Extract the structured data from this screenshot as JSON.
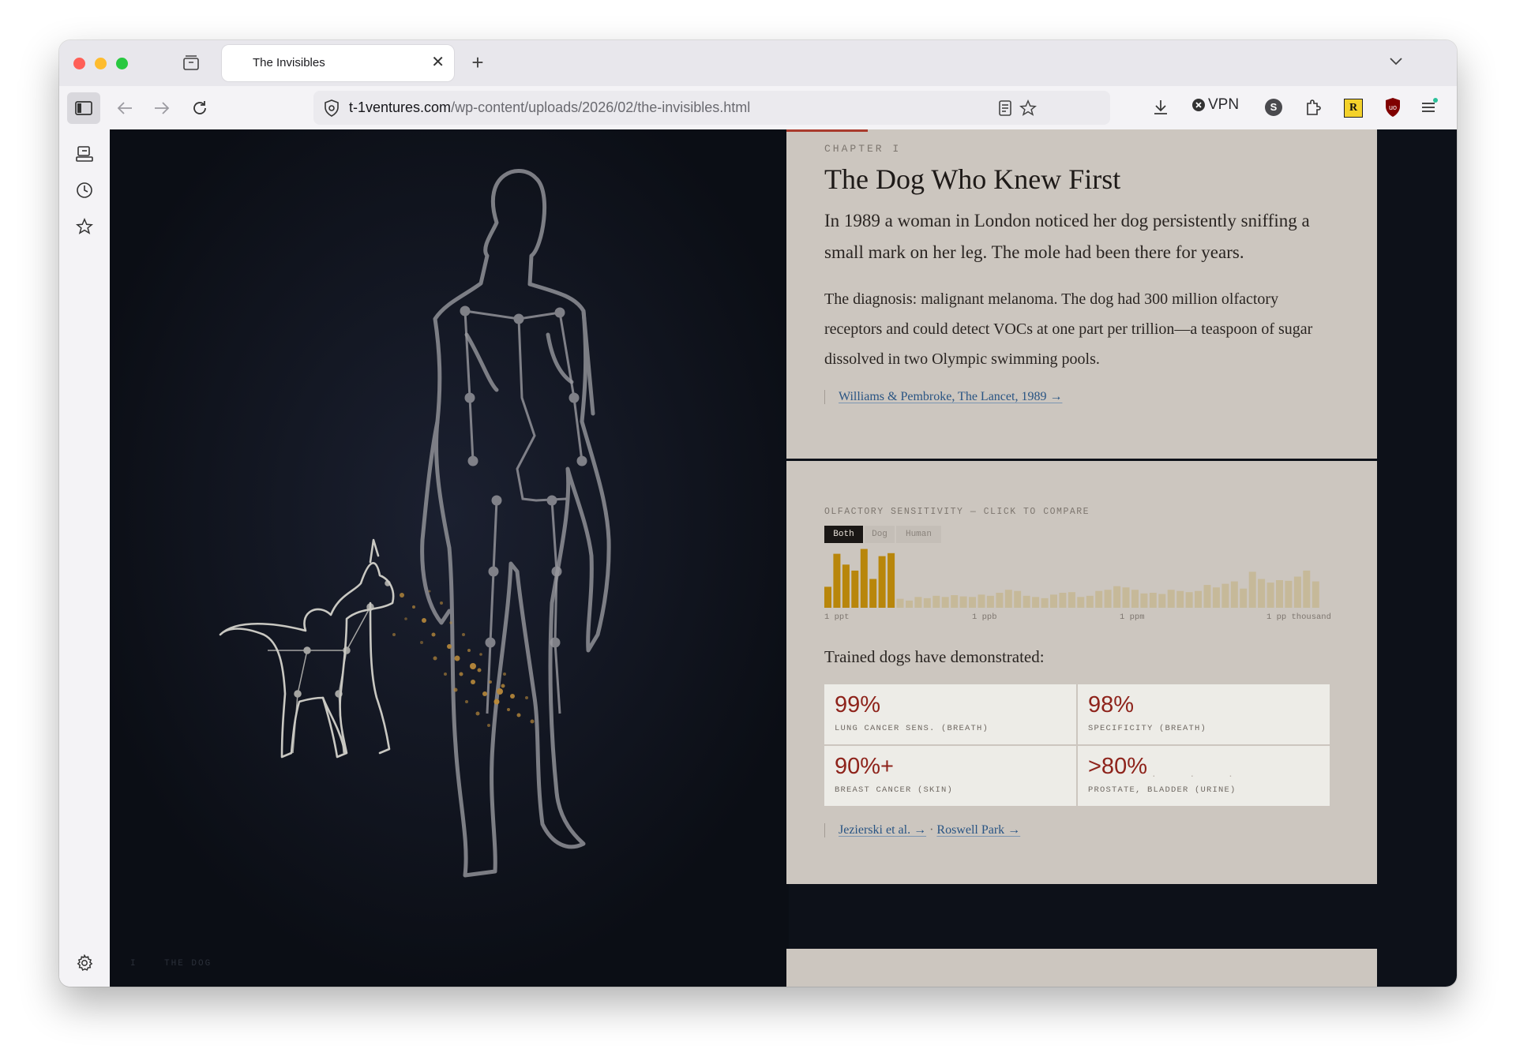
{
  "browser": {
    "tab_title": "The Invisibles",
    "url_host": "t-1ventures.com",
    "url_path": "/wp-content/uploads/2026/02/the-invisibles.html",
    "vpn_label": "VPN",
    "ext_r_label": "R",
    "ext_s_label": "S"
  },
  "chapter": {
    "eyebrow": "CHAPTER I",
    "title": "The Dog Who Knew First",
    "lede": "In 1989 a woman in London noticed her dog persistently sniffing a small mark on her leg. The mole had been there for years.",
    "body": "The diagnosis: malignant melanoma. The dog had 300 million olfactory receptors and could detect VOCs at one part per trillion—a teaspoon of sugar dissolved in two Olympic swimming pools.",
    "citation": "Williams & Pembroke, The Lancet, 1989 →"
  },
  "sensitivity": {
    "title": "OLFACTORY SENSITIVITY — CLICK TO COMPARE",
    "toggles": [
      "Both",
      "Dog",
      "Human"
    ],
    "active_toggle": "Both",
    "trained_heading": "Trained dogs have demonstrated:",
    "stats": [
      {
        "value": "99%",
        "label": "LUNG CANCER SENS. (BREATH)"
      },
      {
        "value": "98%",
        "label": "SPECIFICITY (BREATH)"
      },
      {
        "value": "90%+",
        "label": "BREAST CANCER (SKIN)"
      },
      {
        "value": ">80%",
        "label": "PROSTATE, BLADDER (URINE)"
      }
    ],
    "links": [
      "Jezierski et al. →",
      "Roswell Park →"
    ],
    "link_separator": "·"
  },
  "chart_data": {
    "type": "bar",
    "title": "OLFACTORY SENSITIVITY — CLICK TO COMPARE",
    "xlabel": "",
    "ylabel": "",
    "x_tick_labels": [
      "1 ppt",
      "1 ppb",
      "1 ppm",
      "1 pp thousand"
    ],
    "series": [
      {
        "name": "Dog",
        "color": "#b8860b",
        "values": [
          0.35,
          0.9,
          0.72,
          0.62,
          0.98,
          0.48,
          0.86,
          0.91
        ]
      },
      {
        "name": "Human",
        "color": "#c4b48c",
        "values": [
          0.15,
          0.12,
          0.18,
          0.16,
          0.2,
          0.18,
          0.21,
          0.19,
          0.18,
          0.22,
          0.2,
          0.25,
          0.3,
          0.28,
          0.2,
          0.18,
          0.16,
          0.22,
          0.25,
          0.26,
          0.18,
          0.2,
          0.28,
          0.3,
          0.36,
          0.34,
          0.3,
          0.24,
          0.25,
          0.23,
          0.3,
          0.28,
          0.26,
          0.28,
          0.38,
          0.34,
          0.4,
          0.44,
          0.32,
          0.6,
          0.48,
          0.42,
          0.46,
          0.45,
          0.52,
          0.62,
          0.44
        ]
      }
    ]
  },
  "footer": {
    "section_number": "I",
    "section_label": "THE DOG",
    "dots": "· · ·"
  },
  "colors": {
    "page_bg": "#0d1119",
    "card_bg": "#ccc6bf",
    "accent_gold": "#b8860b",
    "stat_red": "#8e231b",
    "link_blue": "#295483"
  }
}
